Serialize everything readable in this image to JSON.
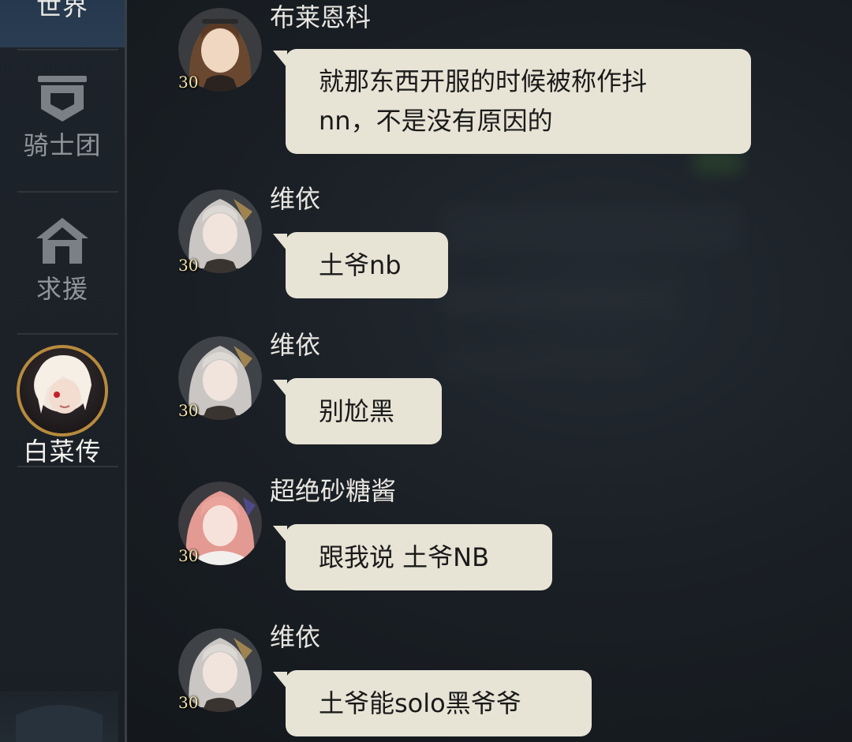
{
  "sidebar": {
    "tabs": [
      {
        "label": "世界",
        "icon": "globe-icon"
      },
      {
        "label": "骑士团",
        "icon": "shield-icon"
      },
      {
        "label": "求援",
        "icon": "house-icon"
      },
      {
        "label": "白菜传",
        "icon": "character-avatar"
      }
    ]
  },
  "messages": [
    {
      "sender": "布莱恩科",
      "level": "30",
      "lines": [
        "就那东西开服的时候被称作抖",
        "nn，不是没有原因的"
      ]
    },
    {
      "sender": "维依",
      "level": "30",
      "lines": [
        "土爷nb"
      ]
    },
    {
      "sender": "维依",
      "level": "30",
      "lines": [
        "别尬黑"
      ]
    },
    {
      "sender": "超绝砂糖酱",
      "level": "30",
      "lines": [
        "跟我说 土爷NB"
      ]
    },
    {
      "sender": "维依",
      "level": "30",
      "lines": [
        "土爷能solo黑爷爷"
      ]
    }
  ],
  "colors": {
    "bubble": "#e7e3d5",
    "active_tab": "#2a3d52",
    "level_text": "#f3e2a8"
  }
}
